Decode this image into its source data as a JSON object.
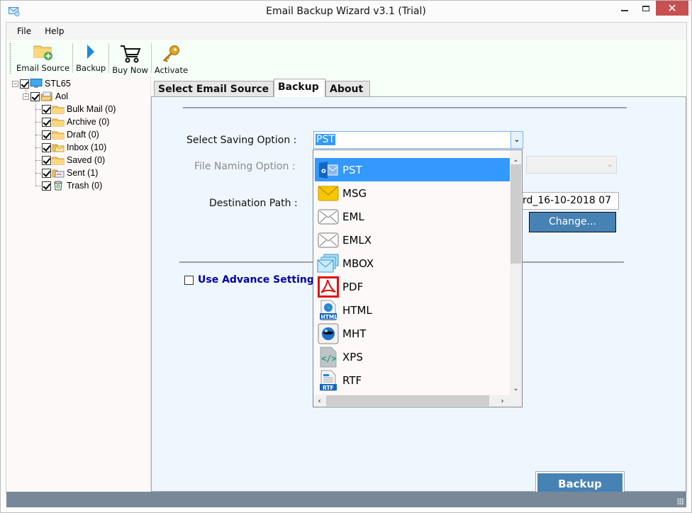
{
  "window": {
    "title": "Email Backup Wizard v3.1 (Trial)",
    "app_icon": "mail-download-icon",
    "controls": {
      "minimize": "minimize-icon",
      "maximize": "maximize-icon",
      "close": "✕"
    }
  },
  "menu": {
    "items": [
      {
        "label": "File"
      },
      {
        "label": "Help"
      }
    ]
  },
  "toolbar": {
    "buttons": [
      {
        "label": "Email Source",
        "icon": "folder-add-icon"
      },
      {
        "label": "Backup",
        "icon": "play-icon"
      },
      {
        "label": "Buy Now",
        "icon": "cart-icon"
      },
      {
        "label": "Activate",
        "icon": "key-icon"
      }
    ]
  },
  "tree": {
    "root": {
      "label": "STL65",
      "checked": true,
      "icon": "computer-icon"
    },
    "account": {
      "label": "Aol",
      "checked": true,
      "icon": "mail-account-icon"
    },
    "folders": [
      {
        "label": "Bulk Mail (0)",
        "checked": true,
        "icon": "folder-icon"
      },
      {
        "label": "Archive (0)",
        "checked": true,
        "icon": "folder-icon"
      },
      {
        "label": "Draft (0)",
        "checked": true,
        "icon": "folder-icon"
      },
      {
        "label": "Inbox (10)",
        "checked": true,
        "icon": "inbox-icon"
      },
      {
        "label": "Saved (0)",
        "checked": true,
        "icon": "folder-icon"
      },
      {
        "label": "Sent (1)",
        "checked": true,
        "icon": "sent-icon"
      },
      {
        "label": "Trash (0)",
        "checked": true,
        "icon": "trash-icon"
      }
    ]
  },
  "tabs": [
    {
      "label": "Select Email Source",
      "active": false
    },
    {
      "label": "Backup",
      "active": true
    },
    {
      "label": "About",
      "active": false
    }
  ],
  "backup_panel": {
    "saving_option_label": "Select Saving Option :",
    "saving_option_value": "PST",
    "file_naming_label": "File Naming Option :",
    "file_naming_value": "",
    "destination_label": "Destination Path :",
    "destination_value": "rd_16-10-2018 07",
    "change_button": "Change...",
    "advance_settings_label": "Use Advance Settings",
    "advance_settings_checked": false,
    "backup_button": "Backup"
  },
  "dropdown": {
    "selected": "PST",
    "options": [
      {
        "label": "PST",
        "icon": "outlook-icon"
      },
      {
        "label": "MSG",
        "icon": "envelope-yellow-icon"
      },
      {
        "label": "EML",
        "icon": "envelope-icon"
      },
      {
        "label": "EMLX",
        "icon": "envelope-icon"
      },
      {
        "label": "MBOX",
        "icon": "mbox-stack-icon"
      },
      {
        "label": "PDF",
        "icon": "pdf-icon"
      },
      {
        "label": "HTML",
        "icon": "html-globe-icon"
      },
      {
        "label": "MHT",
        "icon": "mht-globe-icon"
      },
      {
        "label": "XPS",
        "icon": "xps-code-icon"
      },
      {
        "label": "RTF",
        "icon": "rtf-doc-icon"
      }
    ]
  },
  "colors": {
    "accent_button": "#4682b4",
    "selection": "#3399ff",
    "status_bar": "#778899",
    "close_button": "#c75050",
    "advance_link": "#0000a0"
  }
}
